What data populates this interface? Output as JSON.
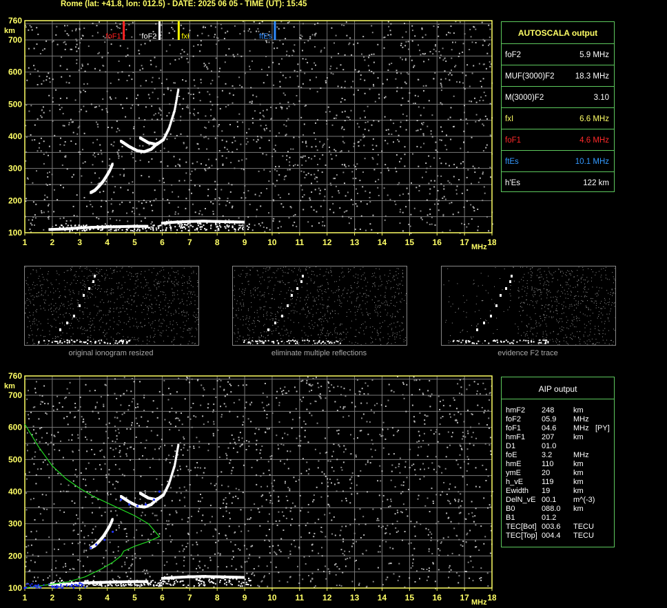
{
  "title": "Rome (lat: +41.8, lon: 012.5) - DATE: 2025 06 05 - TIME (UT): 15:45",
  "colors": {
    "axis_yellow": "#ffff66",
    "grid": "#8a8a8a",
    "box_border": "#5ecb5e",
    "foF1_red": "#ff2020",
    "foF2_white": "#ffffff",
    "fxI_yellow": "#ffff00",
    "ftEs_blue": "#2f8cff",
    "profile_green": "#22dd22",
    "aip_blue": "#2233ff"
  },
  "autoscala": {
    "header": "AUTOSCALA output",
    "rows": [
      {
        "label": "foF2",
        "value": "5.9 MHz",
        "color": "#ffffff"
      },
      {
        "label": "MUF(3000)F2",
        "value": "18.3 MHz",
        "color": "#ffffff"
      },
      {
        "label": "M(3000)F2",
        "value": "3.10",
        "color": "#ffffff"
      },
      {
        "label": "fxI",
        "value": "6.6 MHz",
        "color": "#ffff66"
      },
      {
        "label": "foF1",
        "value": "4.6 MHz",
        "color": "#ff2a2a"
      },
      {
        "label": "ftEs",
        "value": "10.1 MHz",
        "color": "#3399ff"
      },
      {
        "label": "h'Es",
        "value": "122    km",
        "color": "#ffffff"
      }
    ]
  },
  "aip": {
    "header": "AIP output",
    "rows": [
      {
        "name": "hmF2",
        "value": "248",
        "unit": "km",
        "extra": ""
      },
      {
        "name": "foF2",
        "value": "05.9",
        "unit": "MHz",
        "extra": ""
      },
      {
        "name": "foF1",
        "value": "04.6",
        "unit": "MHz",
        "extra": "[PY]"
      },
      {
        "name": "hmF1",
        "value": "207",
        "unit": "km",
        "extra": ""
      },
      {
        "name": "D1",
        "value": "01.0",
        "unit": "",
        "extra": ""
      },
      {
        "name": "foE",
        "value": "3.2",
        "unit": "MHz",
        "extra": ""
      },
      {
        "name": "hmE",
        "value": "110",
        "unit": "km",
        "extra": ""
      },
      {
        "name": "ymE",
        "value": "20",
        "unit": "km",
        "extra": ""
      },
      {
        "name": "h_vE",
        "value": "119",
        "unit": "km",
        "extra": ""
      },
      {
        "name": "Ewidth",
        "value": "19",
        "unit": "km",
        "extra": ""
      },
      {
        "name": "DelN_vE",
        "value": "00.1",
        "unit": "m^(-3)",
        "extra": ""
      },
      {
        "name": "B0",
        "value": "088.0",
        "unit": "km",
        "extra": ""
      },
      {
        "name": "B1",
        "value": "01.2",
        "unit": "",
        "extra": ""
      },
      {
        "name": "TEC[Bot]",
        "value": "003.6",
        "unit": "TECU",
        "extra": ""
      },
      {
        "name": "TEC[Top]",
        "value": "004.4",
        "unit": "TECU",
        "extra": ""
      }
    ]
  },
  "thumb_captions": [
    "original ionogram resized",
    "eliminate multiple reflections",
    "evidence F2 trace"
  ],
  "chart_data": [
    {
      "type": "scatter",
      "title": "",
      "xlabel": "MHz",
      "ylabel": "km",
      "xlim": [
        1,
        18
      ],
      "ylim": [
        100,
        760
      ],
      "x_ticks": [
        "1",
        "2",
        "3",
        "4",
        "5",
        "6",
        "7",
        "8",
        "9",
        "10",
        "11",
        "12",
        "13",
        "14",
        "15",
        "16",
        "17",
        "18"
      ],
      "y_ticks": [
        "100",
        "200",
        "300",
        "400",
        "500",
        "600",
        "700",
        "760"
      ],
      "grid": true,
      "markers": [
        {
          "label": "foF1",
          "x": 4.6,
          "color": "#ff2020"
        },
        {
          "label": "foF2",
          "x": 5.9,
          "color": "#ffffff"
        },
        {
          "label": "fxI",
          "x": 6.6,
          "color": "#ffff00"
        },
        {
          "label": "ftEs",
          "x": 10.1,
          "color": "#2f8cff"
        }
      ],
      "series": [
        {
          "x": [
            3.4,
            3.55,
            3.7,
            3.85,
            4.0,
            4.1,
            4.2
          ],
          "y": [
            225,
            232,
            245,
            260,
            280,
            295,
            315
          ]
        },
        {
          "x": [
            4.5,
            4.8,
            5.1,
            5.35,
            5.6,
            5.85
          ],
          "y": [
            385,
            368,
            355,
            352,
            360,
            380
          ]
        },
        {
          "x": [
            5.2,
            5.5,
            5.8,
            6.05,
            6.25,
            6.45,
            6.6
          ],
          "y": [
            395,
            380,
            375,
            390,
            425,
            480,
            550
          ]
        },
        {
          "x": [
            1.9,
            2.5,
            3.0,
            3.5,
            4.0,
            4.5,
            5.0,
            5.5
          ],
          "y": [
            110,
            112,
            115,
            117,
            118,
            119,
            120,
            120
          ]
        },
        {
          "x": [
            6.0,
            6.5,
            7.0,
            7.5,
            8.0,
            8.5,
            9.0
          ],
          "y": [
            130,
            133,
            135,
            136,
            135,
            134,
            133
          ]
        }
      ]
    },
    {
      "type": "line",
      "title": "",
      "xlabel": "MHz",
      "ylabel": "km",
      "xlim": [
        1,
        18
      ],
      "ylim": [
        100,
        760
      ],
      "x_ticks": [
        "1",
        "2",
        "3",
        "4",
        "5",
        "6",
        "7",
        "8",
        "9",
        "10",
        "11",
        "12",
        "13",
        "14",
        "15",
        "16",
        "17",
        "18"
      ],
      "y_ticks": [
        "100",
        "200",
        "300",
        "400",
        "500",
        "600",
        "700",
        "760"
      ],
      "grid": true,
      "series": [
        {
          "x": [
            1.0,
            1.5,
            2.0,
            2.5,
            3.0,
            3.5,
            4.0,
            4.5,
            5.0,
            5.5,
            5.9,
            5.5,
            5.0,
            4.6,
            4.5,
            4.2,
            3.8,
            3.2,
            2.6,
            2.0,
            1.5,
            1.0
          ],
          "y": [
            610,
            540,
            480,
            440,
            410,
            385,
            365,
            345,
            325,
            300,
            260,
            245,
            230,
            215,
            200,
            180,
            160,
            135,
            120,
            112,
            106,
            100
          ]
        },
        {
          "x": [
            1.0,
            2.0,
            3.0,
            3.4,
            3.6,
            3.9,
            4.2,
            4.5,
            4.8,
            5.1,
            5.4,
            5.7,
            5.9
          ],
          "y": [
            100,
            105,
            115,
            225,
            235,
            250,
            275,
            375,
            360,
            355,
            360,
            375,
            400
          ]
        }
      ]
    }
  ]
}
